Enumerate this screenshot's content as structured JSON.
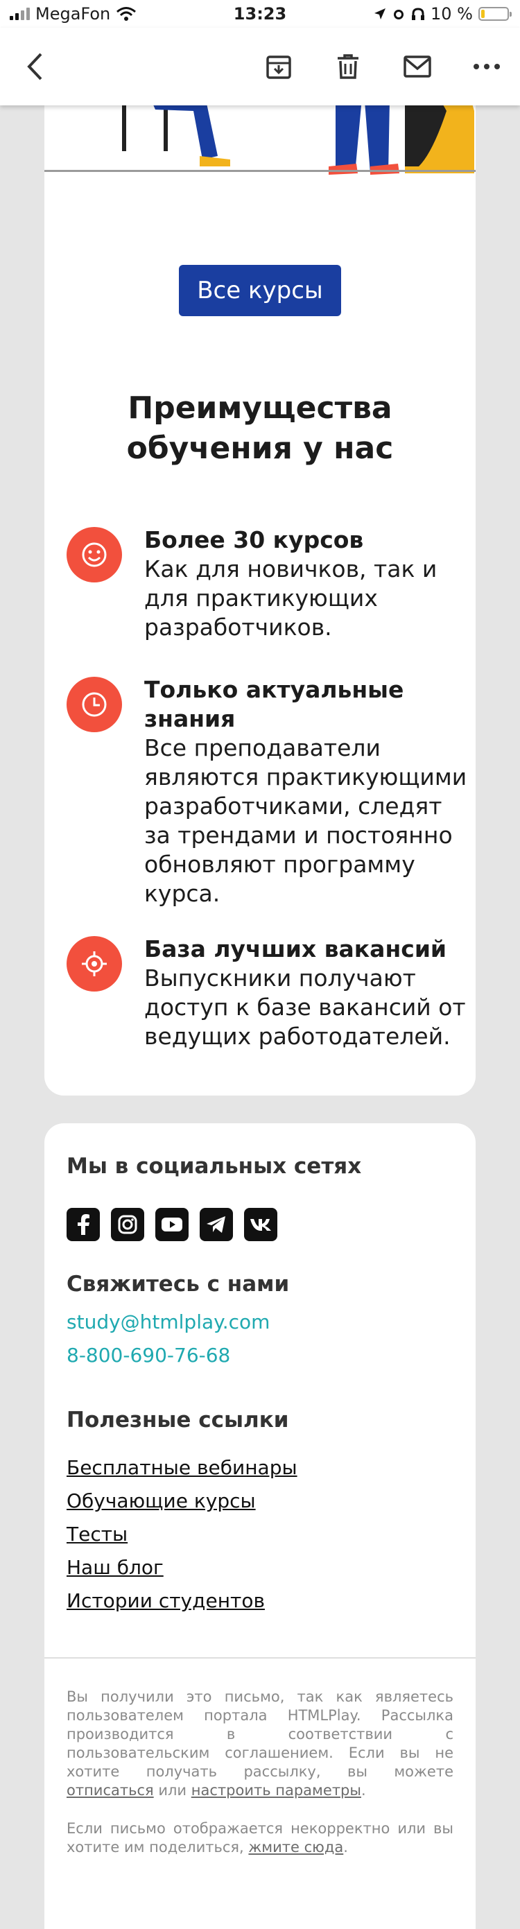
{
  "status": {
    "carrier": "MegaFon",
    "time": "13:23",
    "battery": "10 %"
  },
  "toolbar": {
    "back_icon": "chevron-left-icon",
    "actions": [
      "archive-icon",
      "trash-icon",
      "mail-icon",
      "more-icon"
    ]
  },
  "cta_label": "Все курсы",
  "advantages": {
    "title_line1": "Преимущества",
    "title_line2": "обучения у нас",
    "items": [
      {
        "icon": "smile-icon",
        "title": "Более 30 курсов",
        "lines": [
          "Как для новичков, так и",
          "для практикующих",
          "разработчиков."
        ]
      },
      {
        "icon": "clock-icon",
        "title_lines": [
          "Только актуальные",
          "знания"
        ],
        "lines": [
          "Все преподаватели",
          "являются практикующими",
          "разработчиками, следят",
          "за трендами и постоянно",
          "обновляют программу",
          "курса."
        ]
      },
      {
        "icon": "target-icon",
        "title": "База лучших вакансий",
        "lines": [
          "Выпускники получают",
          "доступ к базе вакансий от",
          "ведущих работодателей."
        ]
      }
    ]
  },
  "footer": {
    "social_title": "Мы в социальных сетях",
    "social": [
      "facebook-icon",
      "instagram-icon",
      "youtube-icon",
      "telegram-icon",
      "vk-icon"
    ],
    "contact_title": "Свяжитесь с нами",
    "email": "study@htmlplay.com",
    "phone": "8-800-690-76-68",
    "links_title": "Полезные ссылки",
    "links": [
      "Бесплатные вебинары",
      "Обучающие курсы",
      "Тесты",
      "Наш блог",
      "Истории студентов"
    ],
    "legal1_pre": "Вы получили это письмо, так как являетесь пользователем портала HTMLPlay. Рассылка производится в соответствии с пользовательским соглашением. Если вы не хотите получать рассылку, вы можете",
    "legal1_unsub": "отписаться",
    "legal1_mid": "или",
    "legal1_settings": "настроить параметры",
    "legal1_end": ".",
    "legal2_pre": "Если письмо отображается некорректно или вы хотите им поделиться,",
    "legal2_link": "жмите сюда",
    "legal2_end": "."
  },
  "colors": {
    "accent_red": "#f2503d",
    "cta_blue": "#1a3ea0",
    "contact_teal": "#1fa9b0"
  }
}
